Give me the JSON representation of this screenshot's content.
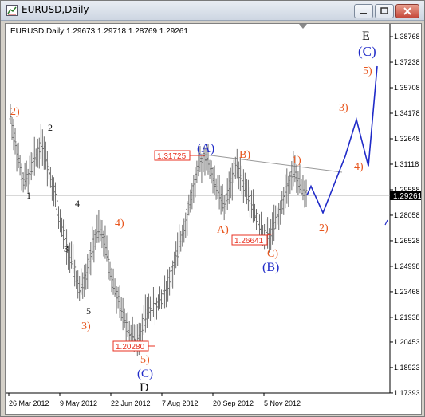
{
  "window": {
    "title": "EURUSD,Daily",
    "buttons": [
      "minimize-icon",
      "restore-icon",
      "close-icon"
    ]
  },
  "chart": {
    "info": "EURUSD,Daily  1.29673 1.29718 1.28769 1.29261",
    "current_price": "1.29261",
    "colors": {
      "wave_orange": "#e8551c",
      "wave_blue": "#1f2ac8",
      "price_box": "#e83020",
      "candles": "#6e6e6e",
      "trendline": "#999999"
    },
    "price_boxes": [
      "1.31725",
      "1.26641",
      "1.20280"
    ],
    "wave_labels": {
      "o_2_left": "2)",
      "o_3_mid": "3)",
      "o_4_mid": "4)",
      "o_5_low": "5)",
      "o_A": "A)",
      "o_B": "B)",
      "o_C": "C)",
      "o_1_right": "1)",
      "o_2_right": "2)",
      "o_3_right": "3)",
      "o_4_right": "4)",
      "o_5_right": "5)",
      "k_1": "1",
      "k_2": "2",
      "k_3": "3",
      "k_4": "4",
      "k_5": "5",
      "b_A": "(A)",
      "b_B": "(B)",
      "b_C_low": "(C)",
      "b_C_high": "(C)",
      "k_D": "D",
      "k_E": "E"
    }
  },
  "chart_data": {
    "type": "line",
    "title": "EURUSD,Daily",
    "ylim": [
      1.1739,
      1.3877
    ],
    "y_ticks": [
      "1.38768",
      "1.37238",
      "1.35708",
      "1.34178",
      "1.32648",
      "1.31118",
      "1.29588",
      "1.28058",
      "1.26528",
      "1.24998",
      "1.23468",
      "1.21938",
      "1.20453",
      "1.18923",
      "1.17393"
    ],
    "x_ticks": [
      "26 Mar 2012",
      "9 May 2012",
      "22 Jun 2012",
      "7 Aug 2012",
      "20 Sep 2012",
      "5 Nov 2012"
    ],
    "series": [
      {
        "values": [
          1.34,
          1.32,
          1.3,
          1.305,
          1.315,
          1.325,
          1.31,
          1.295,
          1.275,
          1.26,
          1.25,
          1.235,
          1.245,
          1.26,
          1.272,
          1.265,
          1.245,
          1.23,
          1.22,
          1.21,
          1.205,
          1.215,
          1.225,
          1.225,
          1.23,
          1.238,
          1.25,
          1.265,
          1.28,
          1.295,
          1.31,
          1.3172,
          1.305,
          1.295,
          1.285,
          1.3,
          1.312,
          1.3,
          1.29,
          1.28,
          1.27,
          1.2664,
          1.275,
          1.285,
          1.298,
          1.308,
          1.298,
          1.2926
        ]
      },
      {
        "values": [
          1.2926,
          1.298,
          1.282,
          1.316,
          1.338,
          1.31,
          1.37
        ]
      }
    ]
  }
}
